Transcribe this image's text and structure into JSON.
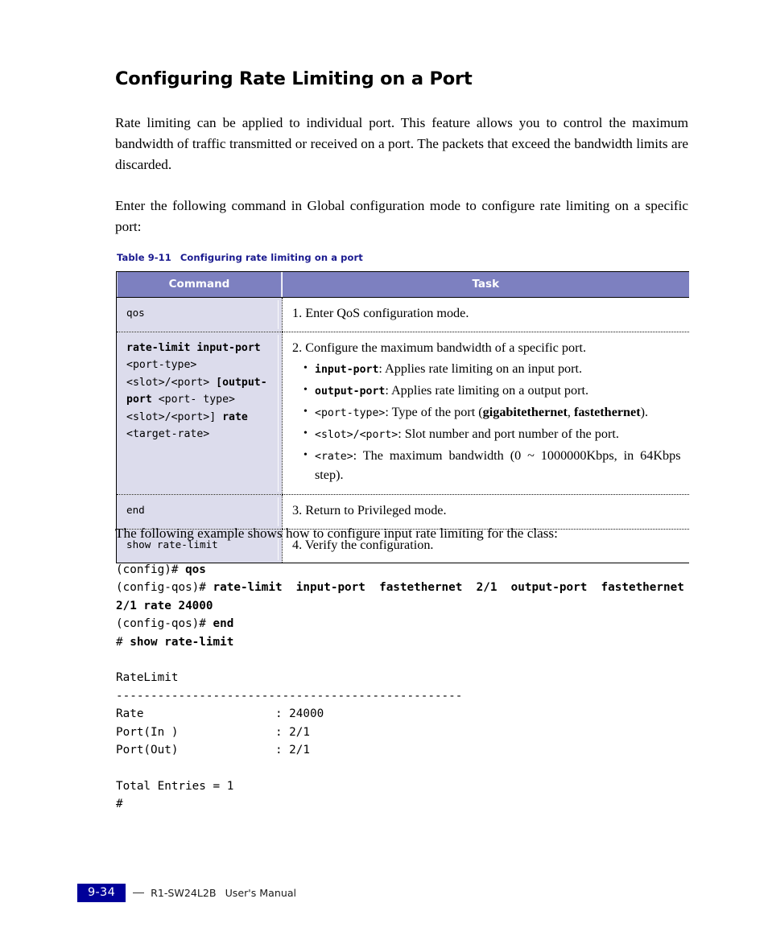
{
  "heading": "Configuring Rate Limiting on a Port",
  "paragraphs": {
    "intro": "Rate limiting can be applied to individual port. This feature allows you to control the maximum bandwidth of traffic transmitted or received on a port. The packets that exceed the bandwidth limits are discarded.",
    "enter_command": "Enter the following command in Global configuration mode to configure rate limiting on a specific port:",
    "example_lead": "The following example shows how to configure input rate limiting for the class:"
  },
  "table": {
    "caption_number": "Table 9-11",
    "caption_text": "Configuring rate limiting on a port",
    "caption_color": "#1a1a8f",
    "header_bg": "#7d80c0",
    "command_cell_bg": "#dcdcec",
    "headers": {
      "command": "Command",
      "task": "Task"
    },
    "rows": [
      {
        "command_plain": "qos",
        "task_head": "1. Enter QoS configuration mode.",
        "bullets": []
      },
      {
        "command_parts": [
          {
            "text": "rate-limit input-port",
            "bold": true
          },
          {
            "text": "\n<port-type>\n<slot>/<port>\n ",
            "bold": false
          },
          {
            "text": "[output-port",
            "bold": true
          },
          {
            "text": " <port-\ntype> <slot>/<port>]\n",
            "bold": false
          },
          {
            "text": "rate",
            "bold": true
          },
          {
            "text": " <target-rate>",
            "bold": false
          }
        ],
        "task_head": "2. Configure the maximum bandwidth of a specific port.",
        "bullets": [
          {
            "term": "input-port",
            "term_style": "mono-bold",
            "desc": ": Applies rate limiting on an input port."
          },
          {
            "term": "output-port",
            "term_style": "mono-bold",
            "desc": ": Applies rate limiting on a output port."
          },
          {
            "term": "<port-type>",
            "term_style": "mono",
            "desc": ": Type of the port (",
            "emph": [
              "gigabitethernet",
              "fastethernet"
            ],
            "desc_tail": ")."
          },
          {
            "term": "<slot>/<port>",
            "term_style": "mono",
            "desc": ": Slot number and port number of the port."
          },
          {
            "term": "<rate>",
            "term_style": "mono",
            "desc": ": The maximum bandwidth (0 ~ 1000000Kbps, in 64Kbps step)."
          }
        ]
      },
      {
        "command_plain": "end",
        "task_head": "3. Return to Privileged mode.",
        "bullets": []
      },
      {
        "command_plain": "show rate-limit",
        "task_head": "4. Verify the configuration.",
        "bullets": []
      }
    ]
  },
  "console": {
    "lines": [
      [
        {
          "t": "(config)# ",
          "b": false
        },
        {
          "t": "qos",
          "b": true
        }
      ],
      [
        {
          "t": "(config-qos)# ",
          "b": false
        },
        {
          "t": "rate-limit  input-port  fastethernet  2/1  output-port  fastethernet 2/1 rate 24000",
          "b": true
        }
      ],
      [
        {
          "t": "(config-qos)# ",
          "b": false
        },
        {
          "t": "end",
          "b": true
        }
      ],
      [
        {
          "t": "# ",
          "b": false
        },
        {
          "t": "show rate-limit",
          "b": true
        }
      ],
      [
        {
          "t": "",
          "b": false
        }
      ],
      [
        {
          "t": "RateLimit",
          "b": false
        }
      ],
      [
        {
          "t": "--------------------------------------------------",
          "b": false
        }
      ],
      [
        {
          "t": "Rate                   : 24000",
          "b": false
        }
      ],
      [
        {
          "t": "Port(In )              : 2/1",
          "b": false
        }
      ],
      [
        {
          "t": "Port(Out)              : 2/1",
          "b": false
        }
      ],
      [
        {
          "t": "",
          "b": false
        }
      ],
      [
        {
          "t": "Total Entries = 1",
          "b": false
        }
      ],
      [
        {
          "t": "#",
          "b": false
        }
      ]
    ]
  },
  "footer": {
    "page_number": "9-34",
    "badge_color": "#000099",
    "product": "R1-SW24L2B",
    "manual": "User's Manual"
  }
}
